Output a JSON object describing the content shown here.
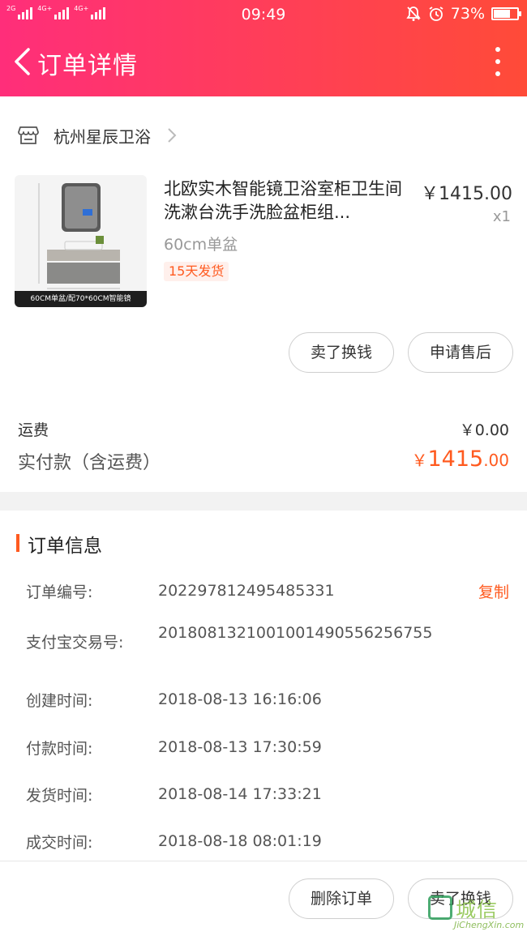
{
  "status_bar": {
    "left": "2G 4G+ 4G+",
    "time": "09:49",
    "battery": "73%",
    "battery_level": 0.73
  },
  "header": {
    "title": "订单详情"
  },
  "shop": {
    "name": "杭州星辰卫浴"
  },
  "product": {
    "title": "北欧实木智能镜卫浴室柜卫生间洗漱台洗手洗脸盆柜组...",
    "price": "￥1415.00",
    "quantity": "x1",
    "spec": "60cm单盆",
    "badge": "15天发货",
    "image_caption": "60CM单盆/配70*60CM智能镜"
  },
  "actions": {
    "sell": "卖了换钱",
    "after_sale": "申请售后"
  },
  "totals": {
    "shipping_label": "运费",
    "shipping_value": "￥0.00",
    "paid_label": "实付款（含运费）",
    "paid_currency": "￥",
    "paid_int": "1415",
    "paid_dec": ".00"
  },
  "order_info": {
    "title": "订单信息",
    "copy": "复制",
    "rows": [
      {
        "label": "订单编号:",
        "value": "202297812495485331"
      },
      {
        "label": "支付宝交易号:",
        "value": "2018081321001001490556256755"
      },
      {
        "label": "创建时间:",
        "value": "2018-08-13 16:16:06"
      },
      {
        "label": "付款时间:",
        "value": "2018-08-13 17:30:59"
      },
      {
        "label": "发货时间:",
        "value": "2018-08-14 17:33:21"
      },
      {
        "label": "成交时间:",
        "value": "2018-08-18 08:01:19"
      }
    ]
  },
  "bottom": {
    "delete": "删除订单",
    "sell": "卖了换钱"
  },
  "watermark": {
    "cn": "城信",
    "en": "JiChengXin.com"
  },
  "colors": {
    "header_start": "#ff2e7a",
    "header_end": "#ff4b38",
    "accent": "#ff5a1f"
  }
}
